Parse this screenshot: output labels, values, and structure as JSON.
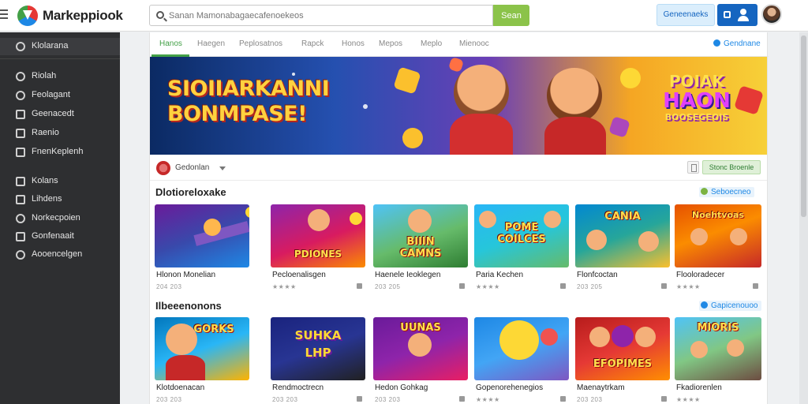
{
  "app": {
    "brand": "Markeppiook",
    "search_placeholder": "Sanan Mamonabagaecafenoekeos",
    "search_button": "Sean",
    "top_pill": "Geneenaeks"
  },
  "sidebar": {
    "items": [
      {
        "label": "Klolarana",
        "icon": "user-icon"
      },
      {
        "label": "Riolah",
        "icon": "person-icon"
      },
      {
        "label": "Feolagant",
        "icon": "circle-icon"
      },
      {
        "label": "Geenacedt",
        "icon": "grid-icon"
      },
      {
        "label": "Raenio",
        "icon": "page-icon"
      },
      {
        "label": "FnenKeplenh",
        "icon": "box-icon"
      },
      {
        "label": "Kolans",
        "icon": "bag-icon"
      },
      {
        "label": "Lihdens",
        "icon": "flag-icon"
      },
      {
        "label": "Norkecpoien",
        "icon": "clock-icon"
      },
      {
        "label": "Gonfenaait",
        "icon": "book-icon"
      },
      {
        "label": "Aooencelgen",
        "icon": "settings-icon"
      }
    ]
  },
  "tabs": {
    "items": [
      "Hanos",
      "Haegen",
      "Peplosatnos",
      "Rapck",
      "Honos",
      "Mepos",
      "Meplo",
      "Mienooc"
    ],
    "active": 0,
    "link": "Gendnane"
  },
  "banner": {
    "title": "SIOIIARKANNI\nBONMPASE!",
    "badge_line1": "POIAK",
    "badge_line2": "HAON",
    "badge_line3": "BOOSEGEOIS"
  },
  "filter": {
    "label": "Gedonlan",
    "button": "Stonc Broenle"
  },
  "sections": [
    {
      "title": "Dlotioreloxake",
      "link": "Seboecneo",
      "link_color": "#7cb342",
      "cards": [
        {
          "title": "Hlonon Monelian",
          "meta": "204 203",
          "thumb_text": ""
        },
        {
          "title": "Pecloenalisgen",
          "meta": "★★★★",
          "thumb_text": "PDIONES"
        },
        {
          "title": "Haenele Ieoklegen",
          "meta": "203 205",
          "thumb_text": "BIIIN\nCAMNS"
        },
        {
          "title": "Paria Kechen",
          "meta": "★★★★",
          "thumb_text": "POME\nCOILCES"
        },
        {
          "title": "Flonfcoctan",
          "meta": "203 205",
          "thumb_text": "CANIA"
        },
        {
          "title": "Flooloradecer",
          "meta": "★★★★",
          "thumb_text": "Noehtvoas"
        }
      ]
    },
    {
      "title": "Ilbeeenonons",
      "link": "Gapicenouoo",
      "link_color": "#1e88e5",
      "cards": [
        {
          "title": "Klotdoenacan",
          "meta": "203 203",
          "thumb_text": "GORKS"
        },
        {
          "title": "Rendmoctrecn",
          "meta": "203 203",
          "thumb_text": "SUHKA\nLHP"
        },
        {
          "title": "Hedon Gohkag",
          "meta": "203 203",
          "thumb_text": "UUNAS"
        },
        {
          "title": "Gopenorehenegios",
          "meta": "★★★★",
          "thumb_text": ""
        },
        {
          "title": "Maenaytrkam",
          "meta": "203 203",
          "thumb_text": "EFOPIMES"
        },
        {
          "title": "Fkadiorenlen",
          "meta": "★★★★",
          "thumb_text": "MIORIS"
        }
      ]
    }
  ]
}
